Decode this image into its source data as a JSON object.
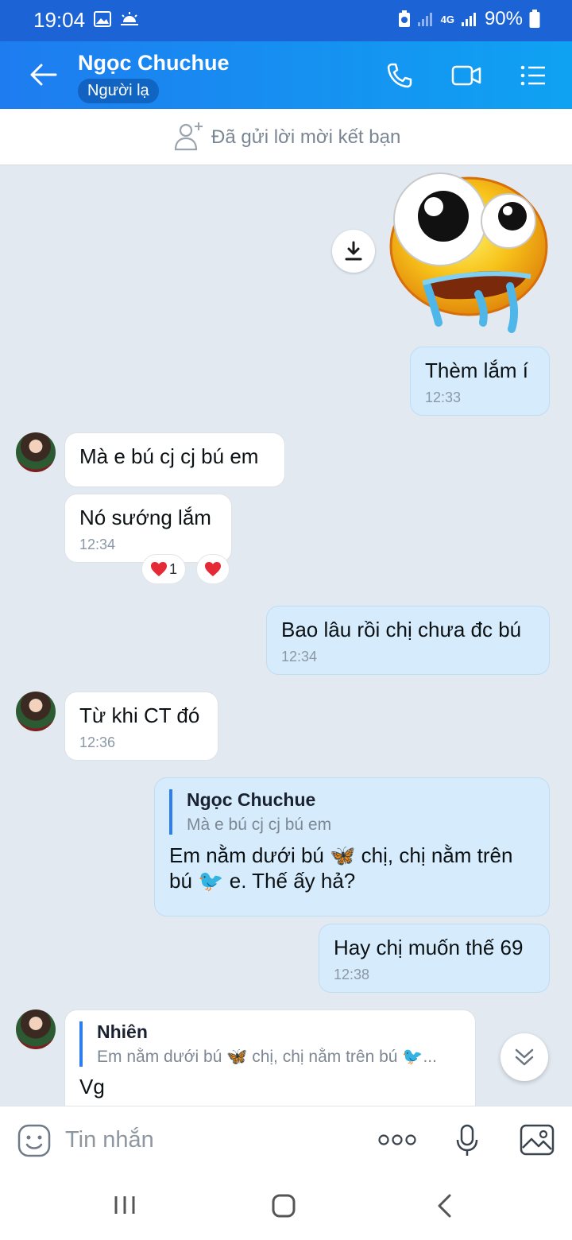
{
  "status": {
    "time": "19:04",
    "battery": "90%",
    "network": "4G"
  },
  "header": {
    "name": "Ngọc Chuchue",
    "badge": "Người lạ"
  },
  "request": {
    "text": "Đã gửi lời mời kết bạn"
  },
  "messages": {
    "m1": {
      "text": "Thèm lắm í",
      "time": "12:33"
    },
    "m2": {
      "text": "Mà e bú cj cj bú em"
    },
    "m3": {
      "text": "Nó sướng lắm",
      "time": "12:34"
    },
    "m3_reaction_count": "1",
    "m4": {
      "text": "Bao lâu rồi chị chưa đc bú",
      "time": "12:34"
    },
    "m5": {
      "text": "Từ khi CT đó",
      "time": "12:36"
    },
    "m6": {
      "quote_name": "Ngọc Chuchue",
      "quote_text": "Mà e bú cj cj bú em",
      "text_line1": "Em nằm dưới bú 🦋 chị, chị nằm trên",
      "text_line2": "bú 🐦 e. Thế ấy hả?"
    },
    "m7": {
      "text": "Hay chị muốn thế 69",
      "time": "12:38"
    },
    "m8": {
      "quote_name": "Nhiên",
      "quote_text": "Em nằm dưới bú 🦋 chị, chị nằm trên bú 🐦...",
      "text": "Vg"
    }
  },
  "composer": {
    "placeholder": "Tin nhắn"
  },
  "colors": {
    "header_start": "#1e7cf0",
    "header_end": "#0fa2f2",
    "outgoing_bubble": "#d6ecfd",
    "incoming_bubble": "#ffffff",
    "chat_bg": "#e2e9f1"
  }
}
